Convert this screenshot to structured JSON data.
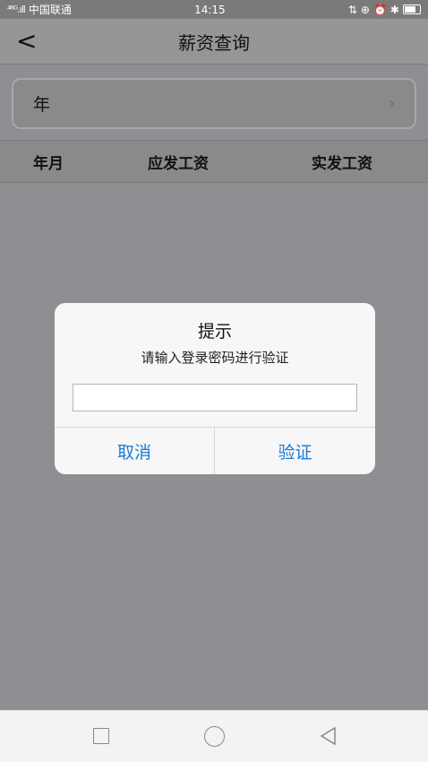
{
  "status_bar": {
    "carrier": "中国联通",
    "signal": "⁴⁶ᴳ.ıll",
    "time": "14:15",
    "icons": [
      "data-icon",
      "location-icon",
      "alarm-icon",
      "bluetooth-icon",
      "battery-icon"
    ]
  },
  "nav": {
    "title": "薪资查询",
    "back_icon": "chevron-left-icon"
  },
  "filter": {
    "year_label": "年",
    "chevron": "›"
  },
  "table": {
    "headers": [
      "年月",
      "应发工资",
      "实发工资"
    ]
  },
  "dialog": {
    "title": "提示",
    "message": "请输入登录密码进行验证",
    "input_value": "",
    "cancel_label": "取消",
    "verify_label": "验证"
  },
  "colors": {
    "accent": "#1a7bd6",
    "overlay": "#8e8e93"
  }
}
